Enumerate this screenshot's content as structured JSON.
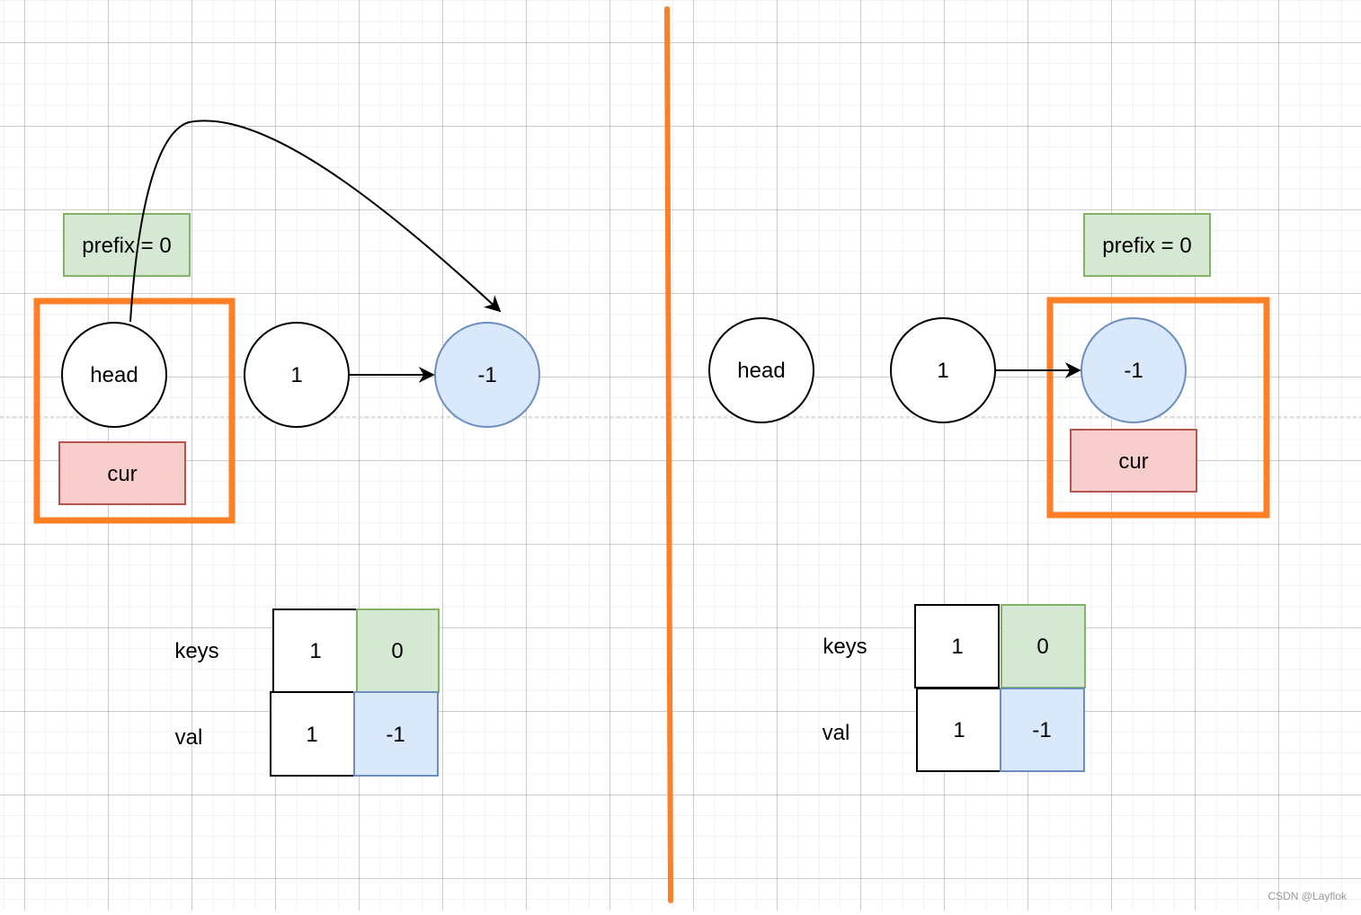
{
  "colors": {
    "highlight": "#ff7f27",
    "green_fill": "#d5e8d4",
    "green_stroke": "#82b366",
    "red_fill": "#f8cecc",
    "red_stroke": "#b85450",
    "blue_fill": "#dae8fc",
    "blue_stroke": "#6c8ebf"
  },
  "left": {
    "prefix": "prefix = 0",
    "nodes": [
      "head",
      "1",
      "-1"
    ],
    "cur": "cur",
    "keys_label": "keys",
    "val_label": "val",
    "keys": [
      "1",
      "0"
    ],
    "vals": [
      "1",
      "-1"
    ]
  },
  "right": {
    "prefix": "prefix = 0",
    "nodes": [
      "head",
      "1",
      "-1"
    ],
    "cur": "cur",
    "keys_label": "keys",
    "val_label": "val",
    "keys": [
      "1",
      "0"
    ],
    "vals": [
      "1",
      "-1"
    ]
  },
  "watermark": "CSDN @Layflok"
}
